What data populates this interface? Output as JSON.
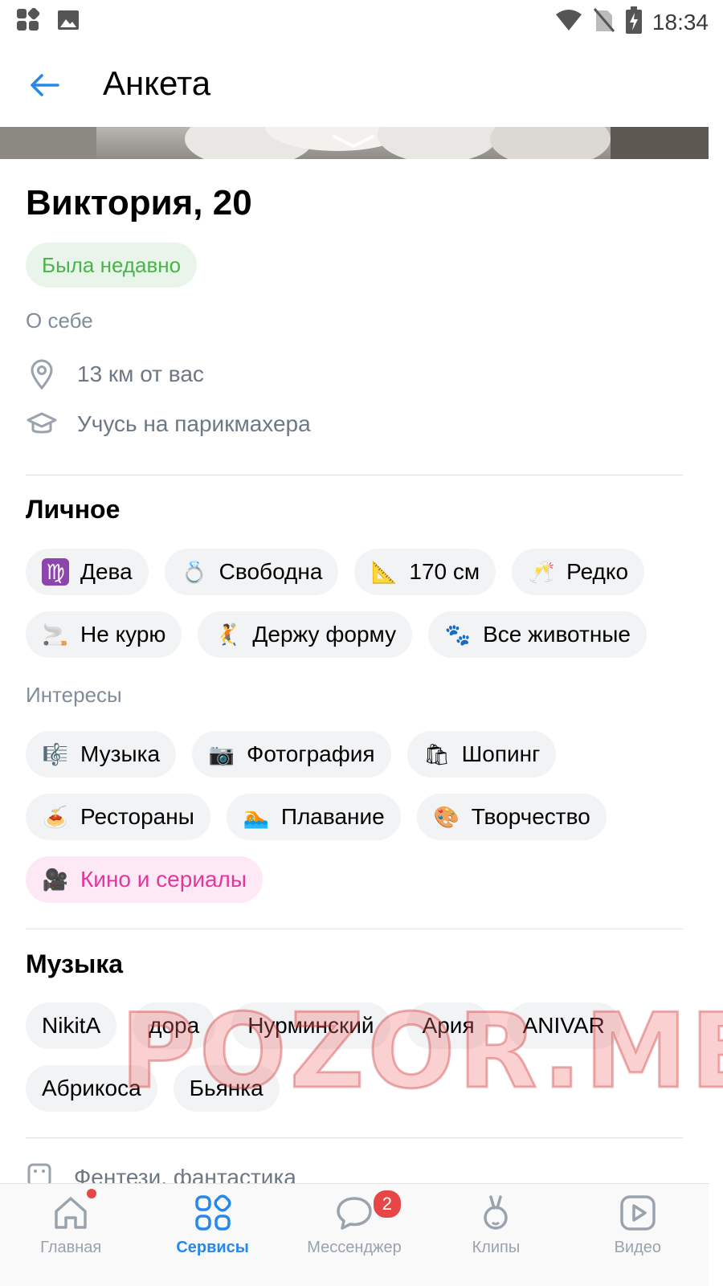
{
  "statusbar": {
    "time": "18:34"
  },
  "header": {
    "title": "Анкета"
  },
  "profile": {
    "name": "Виктория, 20",
    "status": "Была недавно",
    "about_label": "О себе",
    "distance": "13 км от вас",
    "occupation": "Учусь на парикмахера"
  },
  "personal": {
    "title": "Личное",
    "chips": [
      {
        "icon": "virgo-icon",
        "emoji": "♍",
        "label": "Дева"
      },
      {
        "icon": "ring-icon",
        "emoji": "💍",
        "label": "Свободна"
      },
      {
        "icon": "ruler-icon",
        "emoji": "📐",
        "label": "170 см"
      },
      {
        "icon": "champagne-icon",
        "emoji": "🥂",
        "label": "Редко"
      },
      {
        "icon": "no-smoking-icon",
        "emoji": "🚬",
        "label": "Не курю"
      },
      {
        "icon": "sport-icon",
        "emoji": "🤾",
        "label": "Держу форму"
      },
      {
        "icon": "paws-icon",
        "emoji": "🐾",
        "label": "Все животные"
      }
    ]
  },
  "interests": {
    "label": "Интересы",
    "chips": [
      {
        "icon": "music-icon",
        "emoji": "🎼",
        "label": "Музыка"
      },
      {
        "icon": "camera-icon",
        "emoji": "📷",
        "label": "Фотография"
      },
      {
        "icon": "shopping-icon",
        "emoji": "🛍",
        "label": "Шопинг"
      },
      {
        "icon": "spaghetti-icon",
        "emoji": "🍝",
        "label": "Рестораны"
      },
      {
        "icon": "swimmer-icon",
        "emoji": "🏊",
        "label": "Плавание"
      },
      {
        "icon": "palette-icon",
        "emoji": "🎨",
        "label": "Творчество"
      },
      {
        "icon": "movie-camera-icon",
        "emoji": "🎥",
        "label": "Кино и сериалы"
      }
    ]
  },
  "music": {
    "title": "Музыка",
    "chips": [
      "NikitA",
      "дора",
      "Нурминский",
      "Ария",
      "ANIVAR",
      "Абрикоса",
      "Бьянка"
    ]
  },
  "books": {
    "text": "Фентези, фантастика"
  },
  "watermark": "POZOR.ME",
  "tabbar": {
    "tabs": [
      {
        "label": "Главная"
      },
      {
        "label": "Сервисы"
      },
      {
        "label": "Мессенджер",
        "badge": "2"
      },
      {
        "label": "Клипы"
      },
      {
        "label": "Видео"
      }
    ]
  },
  "colors": {
    "accent": "#2688eb",
    "status_green": "#4bb34b",
    "chip_bg": "#f2f3f5",
    "selected_chip_text": "#e4379b",
    "badge_red": "#e64646"
  }
}
